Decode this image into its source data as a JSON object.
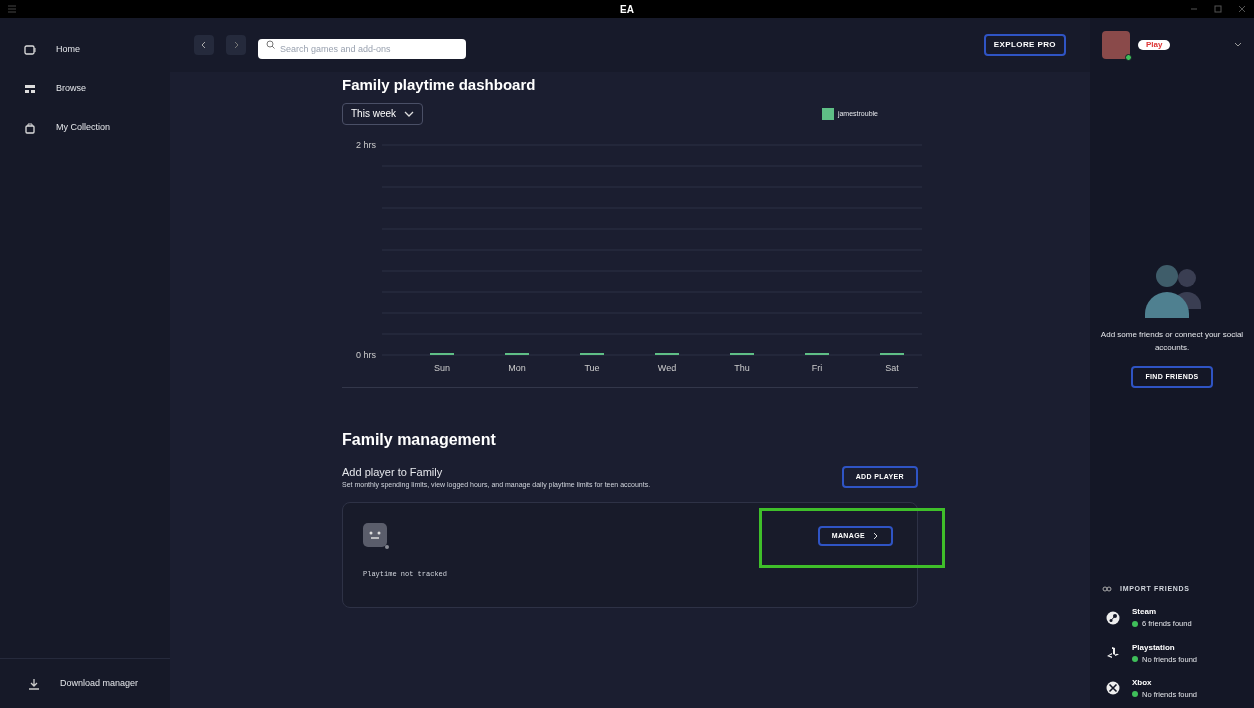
{
  "window": {
    "title": "EA"
  },
  "sidebar": {
    "items": [
      {
        "kind": "home",
        "label": "Home"
      },
      {
        "kind": "browse",
        "label": "Browse"
      },
      {
        "kind": "collection",
        "label": "My Collection"
      }
    ],
    "footer": "Download manager"
  },
  "toolbar": {
    "search": {
      "placeholder": "Search games and add-ons"
    },
    "explore_button": "EXPLORE PRO"
  },
  "profile": {
    "badge": "Play",
    "online": true
  },
  "dashboard": {
    "title": "Family playtime dashboard",
    "range": "This week",
    "chart_data": {
      "type": "bar",
      "categories": [
        "Sun",
        "Mon",
        "Tue",
        "Wed",
        "Thu",
        "Fri",
        "Sat"
      ],
      "series": [
        {
          "name": "jamestrouble",
          "color": "#5fbf86",
          "values": [
            0,
            0,
            0,
            0,
            0,
            0,
            0
          ]
        }
      ],
      "ylim": [
        0,
        2
      ],
      "yticks": [
        {
          "value": 0,
          "label": "0 hrs"
        },
        {
          "value": 2,
          "label": "2 hrs"
        }
      ]
    }
  },
  "family": {
    "title": "Family management",
    "add_title": "Add player to Family",
    "add_description": "Set monthly spending limits, view logged hours, and manage daily playtime limits for teen accounts.",
    "add_button": "ADD PLAYER",
    "member": {
      "status": "Playtime not tracked",
      "button": "MANAGE",
      "highlighted": true
    }
  },
  "friends": {
    "empty_text": "Add some friends or connect your social accounts.",
    "find_button": "FIND FRIENDS",
    "import_title": "IMPORT FRIENDS",
    "sources": [
      {
        "kind": "steam",
        "name": "Steam",
        "status": "6 friends found"
      },
      {
        "kind": "playstation",
        "name": "Playstation",
        "status": "No friends found"
      },
      {
        "kind": "xbox",
        "name": "Xbox",
        "status": "No friends found"
      }
    ]
  }
}
